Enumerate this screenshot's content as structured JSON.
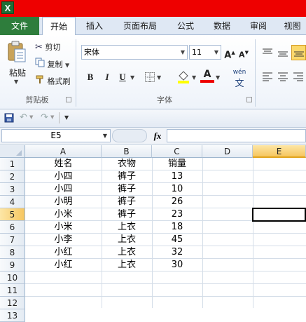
{
  "app": {
    "icon_letter": "X"
  },
  "tabs": [
    "文件",
    "开始",
    "插入",
    "页面布局",
    "公式",
    "数据",
    "审阅",
    "视图"
  ],
  "clipboard": {
    "paste": "粘贴",
    "cut": "剪切",
    "copy": "复制",
    "format_painter": "格式刷",
    "group": "剪贴板"
  },
  "font": {
    "name": "宋体",
    "size": "11",
    "bold": "B",
    "italic": "I",
    "underline": "U",
    "group": "字体",
    "grow": "A",
    "shrink": "A",
    "wen": "wén"
  },
  "name_box": "E5",
  "fx_label": "fx",
  "columns": [
    "A",
    "B",
    "C",
    "D",
    "E"
  ],
  "rows": [
    "1",
    "2",
    "3",
    "4",
    "5",
    "6",
    "7",
    "8",
    "9",
    "10",
    "11",
    "12",
    "13"
  ],
  "sheet": [
    [
      "姓名",
      "衣物",
      "销量"
    ],
    [
      "小四",
      "裤子",
      "13"
    ],
    [
      "小四",
      "裤子",
      "10"
    ],
    [
      "小明",
      "裤子",
      "26"
    ],
    [
      "小米",
      "裤子",
      "23"
    ],
    [
      "小米",
      "上衣",
      "18"
    ],
    [
      "小李",
      "上衣",
      "45"
    ],
    [
      "小红",
      "上衣",
      "32"
    ],
    [
      "小红",
      "上衣",
      "30"
    ]
  ],
  "colors": {
    "title_bar": "#e00000",
    "file_tab": "#2e7d3c",
    "selection": "#f6c660"
  }
}
